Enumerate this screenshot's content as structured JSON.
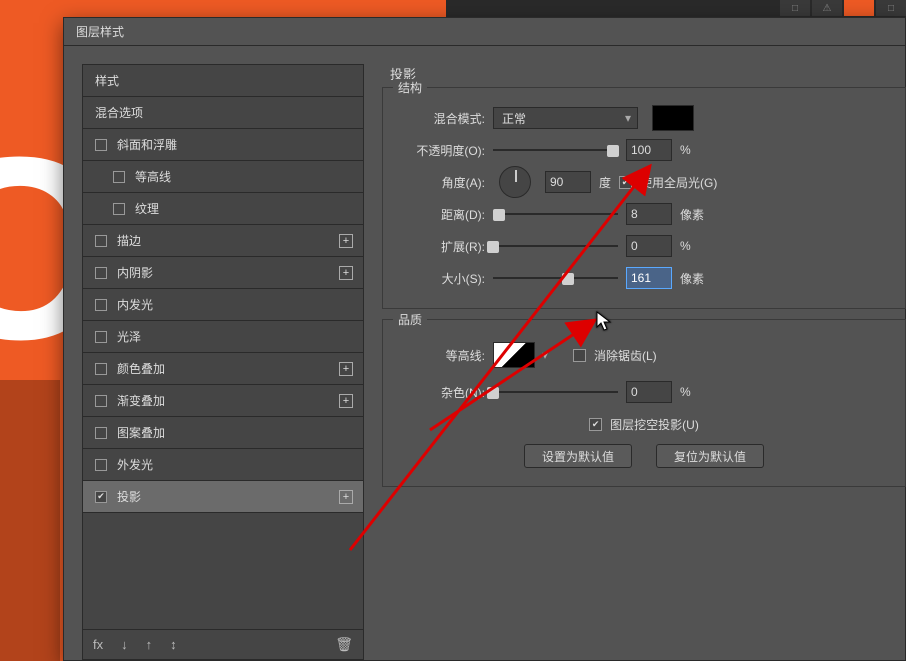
{
  "dialog": {
    "title": "图层样式"
  },
  "sidebar": {
    "header": "样式",
    "items": [
      {
        "label": "混合选项",
        "checkbox": false,
        "plus": false,
        "indent": 0
      },
      {
        "label": "斜面和浮雕",
        "checkbox": true,
        "checked": false,
        "plus": false,
        "indent": 0
      },
      {
        "label": "等高线",
        "checkbox": true,
        "checked": false,
        "plus": false,
        "indent": 1
      },
      {
        "label": "纹理",
        "checkbox": true,
        "checked": false,
        "plus": false,
        "indent": 1
      },
      {
        "label": "描边",
        "checkbox": true,
        "checked": false,
        "plus": true,
        "indent": 0
      },
      {
        "label": "内阴影",
        "checkbox": true,
        "checked": false,
        "plus": true,
        "indent": 0
      },
      {
        "label": "内发光",
        "checkbox": true,
        "checked": false,
        "plus": false,
        "indent": 0
      },
      {
        "label": "光泽",
        "checkbox": true,
        "checked": false,
        "plus": false,
        "indent": 0
      },
      {
        "label": "颜色叠加",
        "checkbox": true,
        "checked": false,
        "plus": true,
        "indent": 0
      },
      {
        "label": "渐变叠加",
        "checkbox": true,
        "checked": false,
        "plus": true,
        "indent": 0
      },
      {
        "label": "图案叠加",
        "checkbox": true,
        "checked": false,
        "plus": false,
        "indent": 0
      },
      {
        "label": "外发光",
        "checkbox": true,
        "checked": false,
        "plus": false,
        "indent": 0
      },
      {
        "label": "投影",
        "checkbox": true,
        "checked": true,
        "plus": true,
        "indent": 0,
        "selected": true
      }
    ],
    "footer_icons": [
      "fx",
      "↓",
      "↑",
      "↕"
    ]
  },
  "main": {
    "title": "投影",
    "structure": {
      "legend": "结构",
      "blend_mode": {
        "label": "混合模式:",
        "value": "正常"
      },
      "opacity": {
        "label": "不透明度(O):",
        "value": "100",
        "unit": "%",
        "pos": 96
      },
      "angle": {
        "label": "角度(A):",
        "value": "90",
        "unit": "度",
        "global": {
          "checked": true,
          "label": "使用全局光(G)"
        }
      },
      "distance": {
        "label": "距离(D):",
        "value": "8",
        "unit": "像素",
        "pos": 5
      },
      "spread": {
        "label": "扩展(R):",
        "value": "0",
        "unit": "%",
        "pos": 0
      },
      "size": {
        "label": "大小(S):",
        "value": "161",
        "unit": "像素",
        "pos": 60
      }
    },
    "quality": {
      "legend": "品质",
      "contour": {
        "label": "等高线:",
        "anti": {
          "checked": false,
          "label": "消除锯齿(L)"
        }
      },
      "noise": {
        "label": "杂色(N):",
        "value": "0",
        "unit": "%",
        "pos": 0
      }
    },
    "knockout": {
      "checked": true,
      "label": "图层挖空投影(U)"
    },
    "btn_default": "设置为默认值",
    "btn_reset": "复位为默认值"
  }
}
